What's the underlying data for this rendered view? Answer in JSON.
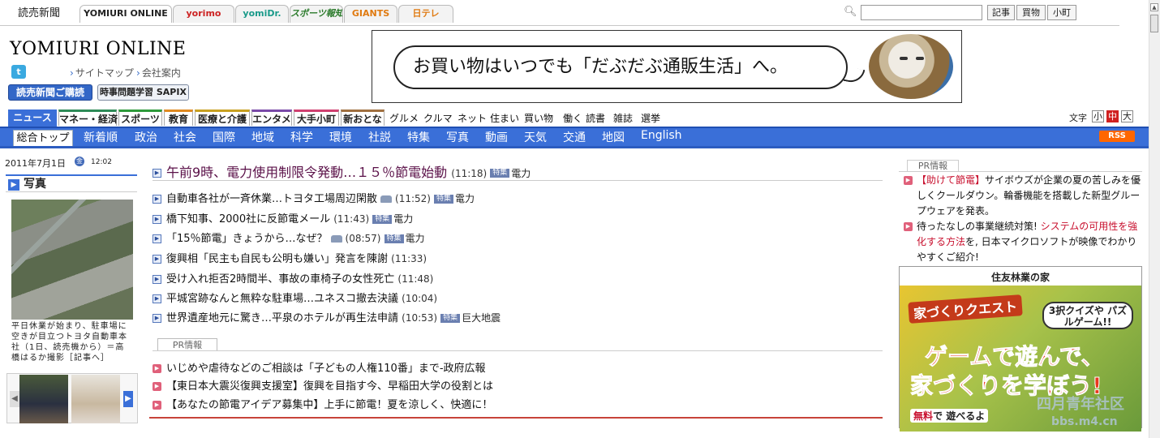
{
  "topbar": {
    "brand": "読売新聞",
    "tabs": [
      "YOMIURI ONLINE",
      "yorimo",
      "yomiDr.",
      "スポーツ報知",
      "GIANTS",
      "日テレ"
    ],
    "tab_colors": [
      "#000000",
      "#cc2222",
      "#1a9a8a",
      "#2a7a2a",
      "#e07a10",
      "#e07a10"
    ],
    "search_placeholder": "",
    "search_buttons": [
      "記事",
      "買物",
      "小町"
    ]
  },
  "header": {
    "logo": "YOMIURI ONLINE",
    "twitter_icon": "t",
    "links": [
      "サイトマップ",
      "会社案内"
    ],
    "subscribe_button": "読売新聞ご購読",
    "sapix_button": "時事問題学習 SAPIX"
  },
  "banner": {
    "text": "お買い物はいつでも「だぶだぶ通販生活」へ。"
  },
  "category_tabs": [
    {
      "label": "ニュース",
      "color": "#3a6fd8"
    },
    {
      "label": "マネー・経済",
      "color": "#2e8b57"
    },
    {
      "label": "スポーツ",
      "color": "#2e9a3a"
    },
    {
      "label": "教育",
      "color": "#e08a20"
    },
    {
      "label": "医療と介護",
      "color": "#c8a020"
    },
    {
      "label": "エンタメ",
      "color": "#7a4aa8"
    },
    {
      "label": "大手小町",
      "color": "#d04070"
    },
    {
      "label": "新おとな",
      "color": "#a07040"
    }
  ],
  "category_links": [
    "グルメ",
    "クルマ",
    "ネット",
    "住まい",
    "買い物",
    "働く",
    "読書",
    "雑誌",
    "選挙"
  ],
  "text_size": {
    "label": "文字",
    "options": [
      "小",
      "中",
      "大"
    ],
    "active": "中"
  },
  "nav": {
    "active": "総合トップ",
    "items": [
      "新着順",
      "政治",
      "社会",
      "国際",
      "地域",
      "科学",
      "環境",
      "社説",
      "特集",
      "写真",
      "動画",
      "天気",
      "交通",
      "地図",
      "English"
    ],
    "rss": "RSS"
  },
  "left": {
    "date": "2011年7月1日",
    "weekday": "金",
    "time": "12:02",
    "photo_heading": "写真",
    "caption": "平日休業が始まり、駐車場に空きが目立つトヨタ自動車本社（1日、読売機から）＝高橋はるか撮影［記事へ］"
  },
  "headline": {
    "title": "午前9時、電力使用制限令発動…１５％節電始動",
    "time": "(11:18)",
    "tag": "特集",
    "tag_word": "電力"
  },
  "news": [
    {
      "title": "自動車各社が一斉休業…トヨタ工場周辺閑散",
      "camera": true,
      "time": "(11:52)",
      "tag": "特集",
      "tag_word": "電力"
    },
    {
      "title": "橋下知事、2000社に反節電メール",
      "camera": false,
      "time": "(11:43)",
      "tag": "特集",
      "tag_word": "電力"
    },
    {
      "title": "「15％節電」きょうから…なぜ？",
      "camera": true,
      "time": "(08:57)",
      "tag": "特集",
      "tag_word": "電力"
    },
    {
      "title": "復興相「民主も自民も公明も嫌い」発言を陳謝",
      "camera": false,
      "time": "(11:33)",
      "tag": "",
      "tag_word": ""
    },
    {
      "title": "受け入れ拒否2時間半、事故の車椅子の女性死亡",
      "camera": false,
      "time": "(11:48)",
      "tag": "",
      "tag_word": ""
    },
    {
      "title": "平城宮跡なんと無粋な駐車場…ユネスコ撤去決議",
      "camera": false,
      "time": "(10:04)",
      "tag": "",
      "tag_word": ""
    },
    {
      "title": "世界遺産地元に驚き…平泉のホテルが再生法申請",
      "camera": false,
      "time": "(10:53)",
      "tag": "特集",
      "tag_word": "巨大地震"
    }
  ],
  "pr": {
    "label": "PR情報",
    "items": [
      "いじめや虐待などのご相談は「子どもの人権110番」まで-政府広報",
      "【東日本大震災復興支援室】復興を目指す今、早稲田大学の役割とは",
      "【あなたの節電アイデア募集中】上手に節電！夏を涼しく、快適に！"
    ]
  },
  "right": {
    "pr_label": "PR情報",
    "item1_red": "【助けて節電】",
    "item1_rest": "サイボウズが企業の夏の苦しみを優しくクールダウン。輪番機能を搭載した新型グループウェアを発表。",
    "item2_lead": "待ったなしの事業継続対策! ",
    "item2_red": "システムの可用性を強化する方法",
    "item2_rest": "を, 日本マイクロソフトが映像でわかりやすくご紹介!",
    "ad_title": "住友林業の家",
    "ad_quest": "家づくりクエスト",
    "ad_quiz": "3択クイズや パズルゲーム!!",
    "ad_game": "ゲームで遊んで、",
    "ad_learn": "家づくりを学ぼう!",
    "ad_free_red": "無料",
    "ad_free_rest": "で 遊べるよ"
  },
  "watermark": {
    "line1": "四月青年社区",
    "line2": "bbs.m4.cn"
  }
}
